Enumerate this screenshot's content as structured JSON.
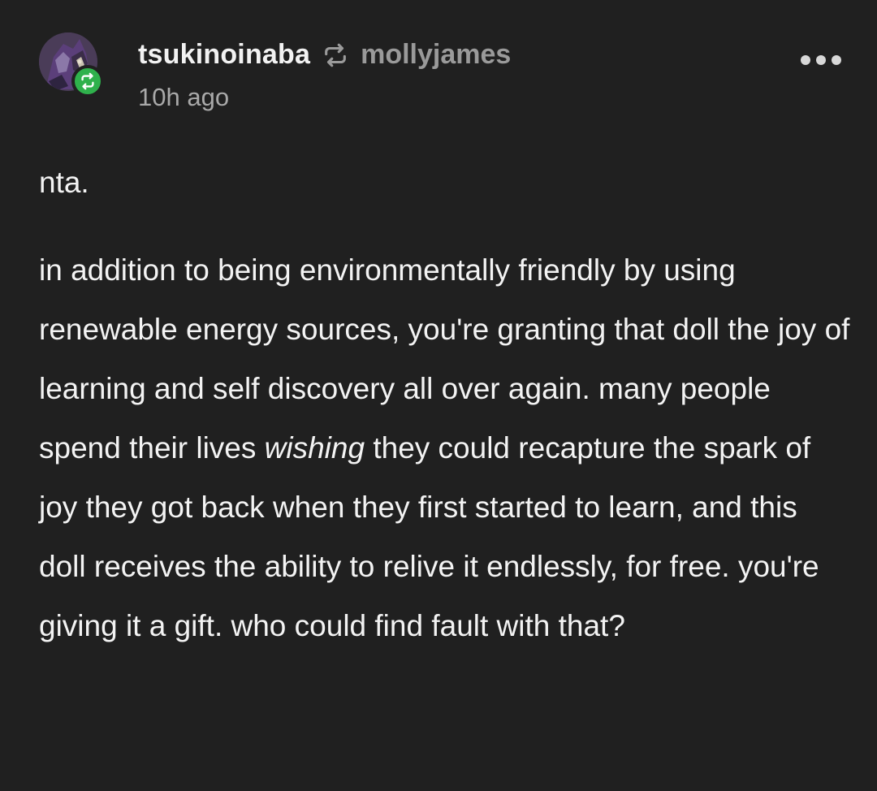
{
  "post": {
    "author": "tsukinoinaba",
    "reblogged_from": "mollyjames",
    "timestamp": "10h ago",
    "avatar_icon": "user-avatar",
    "reblog_icon": "reblog-icon",
    "menu_icon": "more-options-icon",
    "reblog_badge_color": "#2fb14c",
    "body": {
      "line1": "nta.",
      "para_before": "in addition to being environmentally friendly by using renewable energy sources, you're granting that doll the joy of learning and self discovery all over again. many people spend their lives ",
      "para_emphasis": "wishing",
      "para_after": " they could recapture the spark of joy they got back when they first started to learn, and this doll receives the ability to relive it endlessly, for free. you're giving it a gift. who could find fault with that?"
    }
  }
}
